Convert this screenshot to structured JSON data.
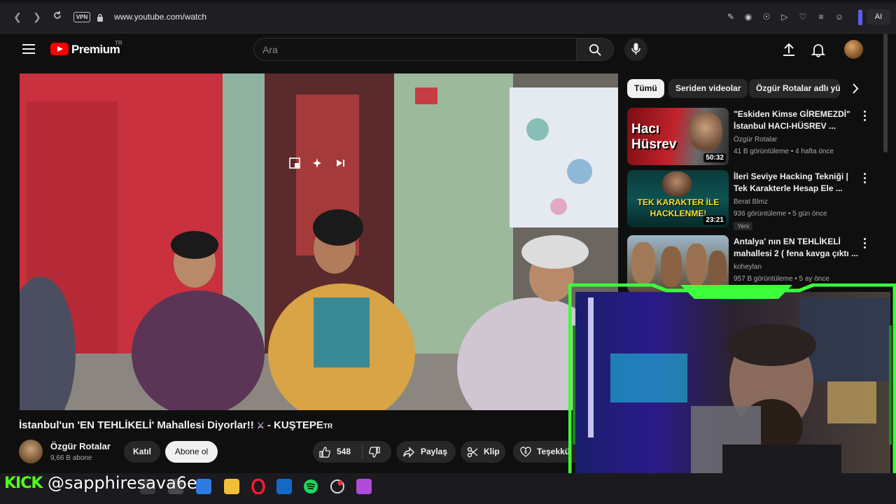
{
  "browser": {
    "url": "www.youtube.com/watch",
    "vpn_label": "VPN",
    "ai_label": "AI"
  },
  "header": {
    "brand": "Premium",
    "region": "TR",
    "search_placeholder": "Ara"
  },
  "video": {
    "title": "İstanbul'un 'EN TEHLİKELİ' Mahallesi Diyorlar!!",
    "title_suffix": "- KUŞTEPE",
    "title_flag": "TR",
    "channel_name": "Özgür Rotalar",
    "subscribers": "9,66 B abone",
    "join_label": "Katıl",
    "subscribe_label": "Abone ol",
    "likes": "548",
    "share_label": "Paylaş",
    "clip_label": "Klip",
    "thanks_label": "Teşekkü"
  },
  "chips": [
    {
      "label": "Tümü",
      "active": true
    },
    {
      "label": "Seriden videolar",
      "active": false
    },
    {
      "label": "Özgür Rotalar adlı yük",
      "active": false
    }
  ],
  "recommendations": [
    {
      "title": "\"Eskiden Kimse GİREMEZDİ\" İstanbul HACI-HÜSREV ...",
      "channel": "Özgür Rotalar",
      "meta": "41 B görüntüleme • 4 hafta önce",
      "duration": "50:32",
      "thumb_text": "Hacı Hüsrev",
      "badge": ""
    },
    {
      "title": "İleri Seviye Hacking Tekniği | Tek Karakterle Hesap Ele ...",
      "channel": "Berat Blmz",
      "meta": "936 görüntüleme • 5 gün önce",
      "duration": "23:21",
      "thumb_text": "TEK KARAKTER İLE HACKLENME!",
      "badge": "Yeni"
    },
    {
      "title": "Antalya' nın EN TEHLİKELİ mahallesi 2 ( fena kavga çıktı ...",
      "channel": "koheylan",
      "meta": "957 B görüntüleme • 5 ay önce",
      "duration": "",
      "thumb_text": "",
      "badge": ""
    }
  ],
  "overlay": {
    "kick_logo": "KICK",
    "handle": "@sapphiresava6e"
  },
  "colors": {
    "accent_red": "#ff0000",
    "kick_green": "#53fc18",
    "background": "#0f0f0f"
  }
}
